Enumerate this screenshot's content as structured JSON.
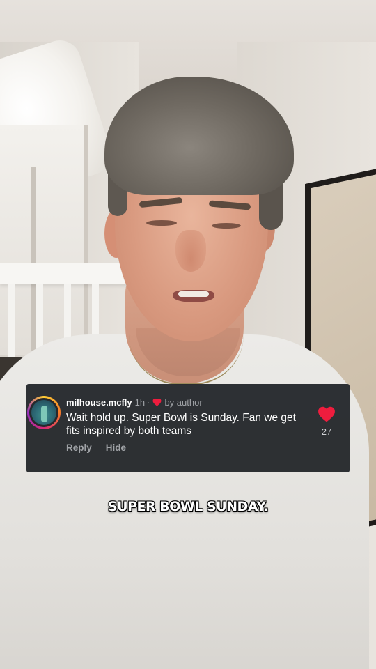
{
  "comment": {
    "username": "milhouse.mcfly",
    "time": "1h",
    "separator": "·",
    "liked_by_label": "by author",
    "text": "Wait hold up. Super Bowl is Sunday. Fan we get fits inspired by both teams",
    "reply_label": "Reply",
    "hide_label": "Hide",
    "like_count": "27"
  },
  "caption": {
    "text": "SUPER BOWL SUNDAY."
  },
  "colors": {
    "card_bg": "#26292d",
    "heart": "#ee1d3e",
    "secondary_text": "#a0a3a7"
  },
  "icons": {
    "author_like": "heart-icon",
    "like_button": "heart-icon"
  }
}
